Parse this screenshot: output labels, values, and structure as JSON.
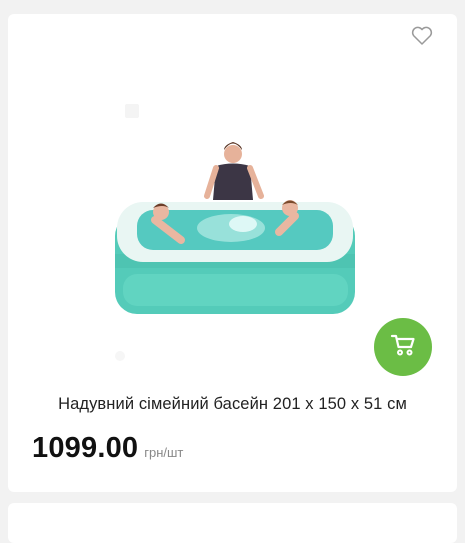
{
  "product": {
    "title": "Надувний сімейний басейн 201 х 150 х 51 см",
    "price": "1099.00",
    "unit": "грн/шт",
    "image_alt": "inflatable-family-pool-photo"
  },
  "icons": {
    "wishlist": "heart-outline-icon",
    "cart": "shopping-cart-icon"
  },
  "colors": {
    "accent": "#6bbd45",
    "pool": "#5ed1c0",
    "background": "#f2f2f2"
  }
}
